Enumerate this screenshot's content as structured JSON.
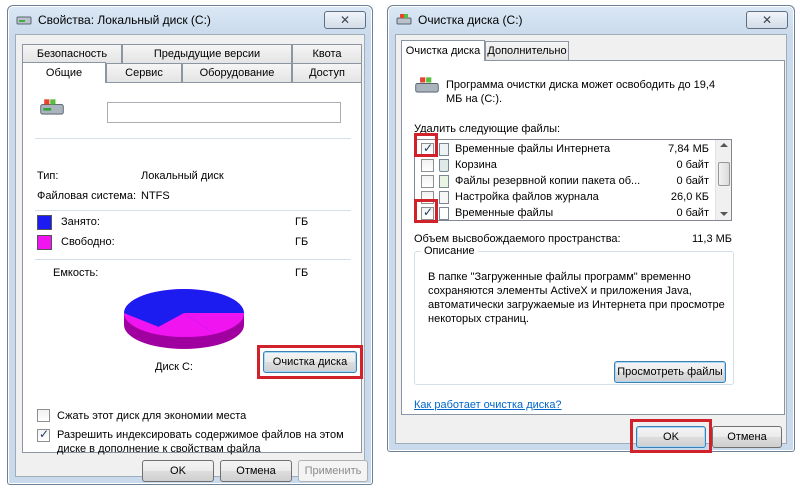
{
  "props": {
    "title": "Свойства: Локальный диск (C:)",
    "tabs_row1": [
      "Безопасность",
      "Предыдущие версии",
      "Квота"
    ],
    "tabs_row2": [
      "Общие",
      "Сервис",
      "Оборудование",
      "Доступ"
    ],
    "type_label": "Тип:",
    "type_value": "Локальный диск",
    "fs_label": "Файловая система:",
    "fs_value": "NTFS",
    "used_label": "Занято:",
    "used_unit": "ГБ",
    "free_label": "Свободно:",
    "free_unit": "ГБ",
    "capacity_label": "Емкость:",
    "capacity_unit": "ГБ",
    "disk_label": "Диск C:",
    "cleanup_button": "Очистка диска",
    "compress_label": "Сжать этот диск для экономии места",
    "index_label_line1": "Разрешить индексировать содержимое файлов на этом",
    "index_label_line2": "диске в дополнение к свойствам файла",
    "ok": "OK",
    "cancel": "Отмена",
    "apply": "Применить",
    "colors": {
      "used": "#1c1cf0",
      "free": "#f014f0"
    }
  },
  "cleanup": {
    "title": "Очистка диска  (C:)",
    "tabs": [
      "Очистка диска",
      "Дополнительно"
    ],
    "intro_line1": "Программа очистки диска может освободить до 19,4",
    "intro_line2": "МБ на  (C:).",
    "delete_label": "Удалить следующие файлы:",
    "files": [
      {
        "name": "Временные файлы Интернета",
        "size": "7,84 МБ",
        "checked": true
      },
      {
        "name": "Корзина",
        "size": "0 байт",
        "checked": false
      },
      {
        "name": "Файлы резервной копии пакета об...",
        "size": "0 байт",
        "checked": false
      },
      {
        "name": "Настройка файлов журнала",
        "size": "26,0 КБ",
        "checked": false
      },
      {
        "name": "Временные файлы",
        "size": "0 байт",
        "checked": true
      }
    ],
    "total_label": "Объем высвобождаемого пространства:",
    "total_value": "11,3 МБ",
    "desc_title": "Описание",
    "desc_lines": [
      "В папке \"Загруженные файлы программ\" временно",
      "сохраняются элементы ActiveX и приложения Java,",
      "автоматически загружаемые из Интернета при просмотре",
      "некоторых страниц."
    ],
    "view_files": "Просмотреть файлы",
    "help_link": "Как работает очистка диска?",
    "ok": "OK",
    "cancel": "Отмена"
  }
}
